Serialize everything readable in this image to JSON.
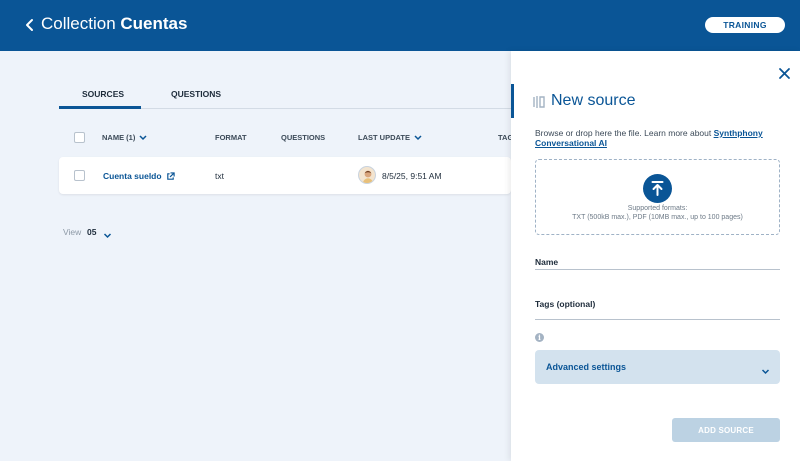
{
  "header": {
    "title_prefix": "Collection",
    "title_name": "Cuentas",
    "training_label": "TRAINING",
    "accent_color": "#0a5596"
  },
  "tabs": [
    {
      "label": "SOURCES",
      "active": true
    },
    {
      "label": "QUESTIONS",
      "active": false
    }
  ],
  "table": {
    "columns": [
      "NAME (1)",
      "FORMAT",
      "QUESTIONS",
      "LAST UPDATE",
      "TAG"
    ],
    "rows": [
      {
        "name": "Cuenta sueldo",
        "format": "txt",
        "questions": "",
        "last_update": "8/5/25, 9:51 AM"
      }
    ]
  },
  "pagination": {
    "view_label": "View",
    "view_value": "05"
  },
  "panel": {
    "title": "New source",
    "help_text": "Browse or drop here the file. Learn more about ",
    "help_link": "Synthphony Conversational AI",
    "formats_line1": "Supported formats:",
    "formats_line2": "TXT (500kB max.), PDF (10MB max., up to 100 pages)",
    "name_label": "Name",
    "tags_label": "Tags (optional)",
    "info_glyph": "i",
    "advanced_label": "Advanced settings",
    "add_button": "ADD SOURCE"
  },
  "icons": [
    "back-chevron-icon",
    "caret-down-icon",
    "external-link-icon",
    "user-avatar-icon",
    "close-icon",
    "new-source-icon",
    "upload-icon",
    "info-icon"
  ]
}
